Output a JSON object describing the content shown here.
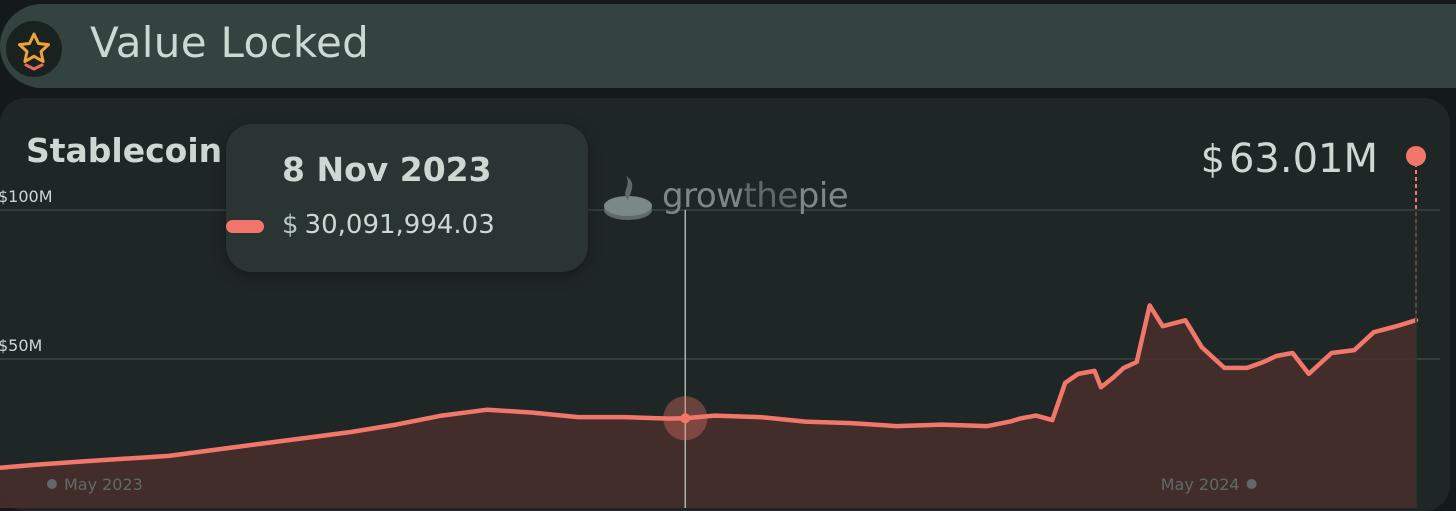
{
  "header": {
    "title": "Value Locked",
    "icon": "star-icon"
  },
  "card": {
    "title": "Stablecoin Market Cap",
    "link_icon": "arrow-right-icon",
    "current_value_symbol": "$",
    "current_value": "63.01M"
  },
  "tooltip": {
    "date": "8 Nov 2023",
    "value_symbol": "$",
    "value": "30,091,994.03"
  },
  "watermark": {
    "part1": "grow",
    "part2": "the",
    "part3": "pie"
  },
  "colors": {
    "series": "#f2776a",
    "fill": "#4a2f2b",
    "gridline": "#3a4543",
    "text": "#cdd8d3",
    "muted": "#5f6a67"
  },
  "chart_data": {
    "type": "area",
    "title": "Stablecoin Market Cap",
    "ylabel": "",
    "xlabel": "",
    "ylim": [
      0,
      100
    ],
    "y_unit": "$M",
    "yticks": [
      {
        "value": 100,
        "label": "$100M"
      },
      {
        "value": 50,
        "label": "$50M"
      }
    ],
    "xticks": [
      {
        "date": "2023-05-01",
        "label": "May 2023"
      },
      {
        "date": "2024-05-01",
        "label": "May 2024"
      }
    ],
    "grid": true,
    "x": [
      "2023-04-11",
      "2023-04-22",
      "2023-05-05",
      "2023-05-19",
      "2023-06-02",
      "2023-06-16",
      "2023-06-30",
      "2023-07-14",
      "2023-07-28",
      "2023-08-11",
      "2023-08-25",
      "2023-09-08",
      "2023-09-22",
      "2023-10-06",
      "2023-10-20",
      "2023-11-03",
      "2023-11-08",
      "2023-11-17",
      "2023-12-01",
      "2023-12-15",
      "2023-12-29",
      "2024-01-12",
      "2024-01-26",
      "2024-02-09",
      "2024-02-16",
      "2024-02-19",
      "2024-02-24",
      "2024-02-29",
      "2024-03-04",
      "2024-03-08",
      "2024-03-13",
      "2024-03-15",
      "2024-03-19",
      "2024-03-22",
      "2024-03-26",
      "2024-03-30",
      "2024-04-03",
      "2024-04-10",
      "2024-04-15",
      "2024-04-22",
      "2024-04-29",
      "2024-05-04",
      "2024-05-08",
      "2024-05-13",
      "2024-05-18",
      "2024-05-25",
      "2024-06-01",
      "2024-06-07",
      "2024-06-14",
      "2024-06-20"
    ],
    "series": [
      {
        "values": [
          13.5,
          14.5,
          15.5,
          16.5,
          17.5,
          19.5,
          21.5,
          23.5,
          25.5,
          28,
          31,
          33,
          32,
          30.5,
          30.5,
          30,
          30.1,
          31,
          30.5,
          29,
          28.5,
          27.5,
          28,
          27.5,
          29,
          30,
          31,
          29.5,
          42,
          45,
          46,
          40.5,
          44,
          47,
          49,
          68,
          61,
          63,
          54,
          47,
          47,
          49,
          51,
          52,
          45,
          52,
          53,
          59,
          61,
          63.01
        ]
      }
    ]
  }
}
